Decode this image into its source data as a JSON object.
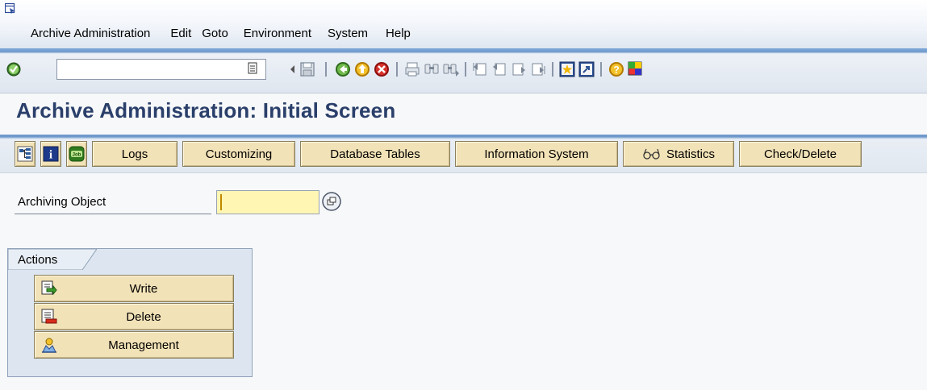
{
  "menu": {
    "items": [
      {
        "label": "Archive Administration"
      },
      {
        "label": "Edit"
      },
      {
        "label": "Goto"
      },
      {
        "label": "Environment"
      },
      {
        "label": "System"
      },
      {
        "label": "Help"
      }
    ]
  },
  "toolbar": {
    "command_value": "",
    "icons": [
      "enter-icon",
      "save-icon",
      "back-icon",
      "exit-icon",
      "cancel-icon",
      "print-icon",
      "find-icon",
      "find-next-icon",
      "first-page-icon",
      "previous-page-icon",
      "next-page-icon",
      "last-page-icon",
      "create-session-icon",
      "shortcut-icon",
      "help-icon",
      "layout-icon"
    ]
  },
  "page": {
    "title": "Archive Administration: Initial Screen"
  },
  "app_toolbar": {
    "logs": "Logs",
    "customizing": "Customizing",
    "database_tables": "Database Tables",
    "information_system": "Information System",
    "statistics": "Statistics",
    "check_delete": "Check/Delete"
  },
  "form": {
    "archiving_object_label": "Archiving Object",
    "archiving_object_value": ""
  },
  "actions": {
    "group_title": "Actions",
    "write": "Write",
    "delete": "Delete",
    "management": "Management"
  },
  "colors": {
    "title": "#2a3f6a",
    "button_bg": "#f2e2b7",
    "input_required_bg": "#fff6b4",
    "group_bg": "#dde6f0"
  }
}
